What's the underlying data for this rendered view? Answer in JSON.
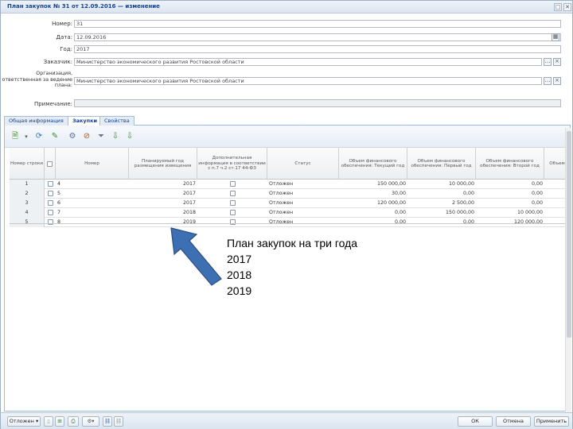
{
  "window": {
    "title": "План закупок № 31 от 12.09.2016 — изменение",
    "controls": [
      "□",
      "✕"
    ]
  },
  "form": {
    "number_label": "Номер:",
    "number_value": "31",
    "date_label": "Дата:",
    "date_value": "12.09.2016",
    "year_label": "Год:",
    "year_value": "2017",
    "customer_label": "Заказчик:",
    "customer_value": "Министерство экономического развития Ростовской области",
    "org_label": "Организация, ответственная за ведение плана:",
    "org_value": "Министерство экономического развития Ростовской области",
    "note_label": "Примечание:",
    "note_value": ""
  },
  "tabs": [
    {
      "label": "Общая информация"
    },
    {
      "label": "Закупки"
    },
    {
      "label": "Свойства"
    }
  ],
  "toolbar": {
    "icons": [
      "add-document-icon",
      "refresh-icon",
      "edit-icon",
      "gear-icon",
      "filter-icon",
      "clear-filter-icon",
      "export-icon",
      "import-icon"
    ]
  },
  "grid": {
    "headers": [
      "Номер строки",
      "",
      "Номер",
      "Планируемый год размещения извещения",
      "Дополнительная информация в соответствии с п.7 ч.2 ст.17 44-ФЗ",
      "Статус",
      "Объем финансового обеспечения: Текущий год",
      "Объем финансового обеспечения: Первый год",
      "Объем финансового обеспечения: Второй год",
      "Объем"
    ],
    "rows": [
      {
        "n": "1",
        "num": "4",
        "year": "2017",
        "status": "Отложен",
        "cur": "150 000,00",
        "first": "10 000,00",
        "second": "0,00"
      },
      {
        "n": "2",
        "num": "5",
        "year": "2017",
        "status": "Отложен",
        "cur": "30,00",
        "first": "0,00",
        "second": "0,00"
      },
      {
        "n": "3",
        "num": "6",
        "year": "2017",
        "status": "Отложен",
        "cur": "120 000,00",
        "first": "2 500,00",
        "second": "0,00"
      },
      {
        "n": "4",
        "num": "7",
        "year": "2018",
        "status": "Отложен",
        "cur": "0,00",
        "first": "150 000,00",
        "second": "10 000,00"
      },
      {
        "n": "5",
        "num": "8",
        "year": "2019",
        "status": "Отложен",
        "cur": "0,00",
        "first": "0,00",
        "second": "120 000,00"
      }
    ]
  },
  "bottom": {
    "status_button": "Отложен",
    "ok": "ОК",
    "cancel": "Отмена",
    "apply": "Применить"
  },
  "annotation": {
    "line1": "План закупок на три года",
    "line2": "2017",
    "line3": "2018",
    "line4": "2019",
    "arrow_color": "#3d6fb3"
  }
}
